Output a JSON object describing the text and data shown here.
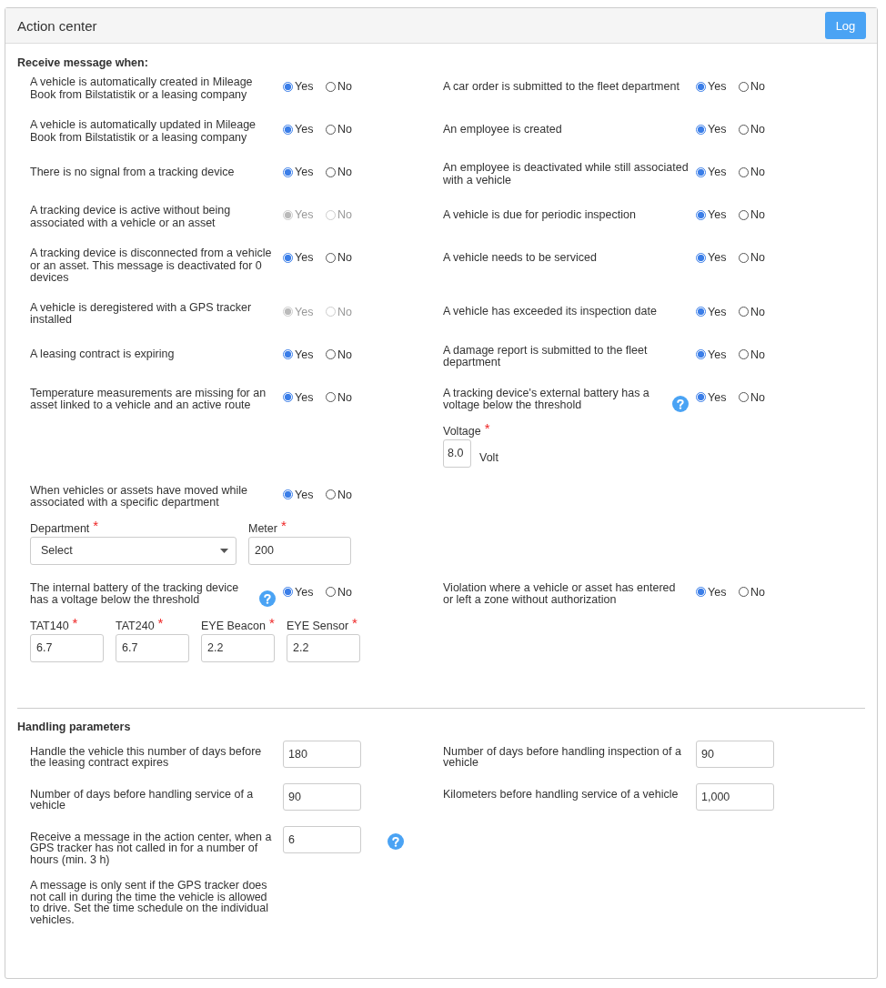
{
  "header": {
    "title": "Action center",
    "log_button": "Log"
  },
  "receive": {
    "title": "Receive message when:",
    "rows": [
      {
        "left": {
          "label": "A vehicle is automatically created in Mileage Book from Bilstatistik or a leasing company",
          "disabled": false,
          "help": false,
          "options": [
            {
              "label": "Yes",
              "selected": true
            },
            {
              "label": "No",
              "selected": false
            }
          ]
        },
        "right": {
          "label": "A car order is submitted to the fleet department",
          "disabled": false,
          "help": false,
          "options": [
            {
              "label": "Yes",
              "selected": true
            },
            {
              "label": "No",
              "selected": false
            }
          ]
        }
      },
      {
        "left": {
          "label": "A vehicle is automatically updated in Mileage Book from Bilstatistik or a leasing company",
          "disabled": false,
          "help": false,
          "options": [
            {
              "label": "Yes",
              "selected": true
            },
            {
              "label": "No",
              "selected": false
            }
          ]
        },
        "right": {
          "label": "An employee is created",
          "disabled": false,
          "help": false,
          "options": [
            {
              "label": "Yes",
              "selected": true
            },
            {
              "label": "No",
              "selected": false
            }
          ]
        }
      },
      {
        "left": {
          "label": "There is no signal from a tracking device",
          "disabled": false,
          "help": false,
          "options": [
            {
              "label": "Yes",
              "selected": true
            },
            {
              "label": "No",
              "selected": false
            }
          ]
        },
        "right": {
          "label": "An employee is deactivated while still associated with a vehicle",
          "disabled": false,
          "help": false,
          "options": [
            {
              "label": "Yes",
              "selected": true
            },
            {
              "label": "No",
              "selected": false
            }
          ]
        }
      },
      {
        "left": {
          "label": "A tracking device is active without being associated with a vehicle or an asset",
          "disabled": true,
          "help": false,
          "options": [
            {
              "label": "Yes",
              "selected": true
            },
            {
              "label": "No",
              "selected": false
            }
          ]
        },
        "right": {
          "label": "A vehicle is due for periodic inspection",
          "disabled": false,
          "help": false,
          "options": [
            {
              "label": "Yes",
              "selected": true
            },
            {
              "label": "No",
              "selected": false
            }
          ]
        }
      },
      {
        "left": {
          "label": "A tracking device is disconnected from a vehicle or an asset. This message is deactivated for 0 devices",
          "disabled": false,
          "help": false,
          "options": [
            {
              "label": "Yes",
              "selected": true
            },
            {
              "label": "No",
              "selected": false
            }
          ]
        },
        "right": {
          "label": "A vehicle needs to be serviced",
          "disabled": false,
          "help": false,
          "options": [
            {
              "label": "Yes",
              "selected": true
            },
            {
              "label": "No",
              "selected": false
            }
          ]
        }
      },
      {
        "left": {
          "label": "A vehicle is deregistered with a GPS tracker installed",
          "disabled": true,
          "help": false,
          "options": [
            {
              "label": "Yes",
              "selected": true
            },
            {
              "label": "No",
              "selected": false
            }
          ]
        },
        "right": {
          "label": "A vehicle has exceeded its inspection date",
          "disabled": false,
          "help": false,
          "options": [
            {
              "label": "Yes",
              "selected": true
            },
            {
              "label": "No",
              "selected": false
            }
          ]
        }
      },
      {
        "left": {
          "label": "A leasing contract is expiring",
          "disabled": false,
          "help": false,
          "options": [
            {
              "label": "Yes",
              "selected": true
            },
            {
              "label": "No",
              "selected": false
            }
          ]
        },
        "right": {
          "label": "A damage report is submitted to the fleet department",
          "disabled": false,
          "help": false,
          "options": [
            {
              "label": "Yes",
              "selected": true
            },
            {
              "label": "No",
              "selected": false
            }
          ]
        }
      },
      {
        "left": {
          "label": "Temperature measurements are missing for an asset linked to a vehicle and an active route",
          "disabled": false,
          "help": false,
          "options": [
            {
              "label": "Yes",
              "selected": true
            },
            {
              "label": "No",
              "selected": false
            }
          ]
        },
        "right": {
          "label": "A tracking device's external battery has a voltage below the threshold",
          "disabled": false,
          "help": true,
          "options": [
            {
              "label": "Yes",
              "selected": true
            },
            {
              "label": "No",
              "selected": false
            }
          ],
          "fields": [
            {
              "kind": "input",
              "label": "Voltage",
              "required_mark": "*",
              "value": "8.0",
              "unit": "Volt"
            }
          ]
        }
      },
      {
        "left": {
          "label": "When vehicles or assets have moved while associated with a specific department",
          "disabled": false,
          "help": false,
          "options": [
            {
              "label": "Yes",
              "selected": true
            },
            {
              "label": "No",
              "selected": false
            }
          ],
          "fields": [
            {
              "kind": "select",
              "label": "Department",
              "required_mark": "*",
              "value": "Select"
            },
            {
              "kind": "input",
              "label": "Meter",
              "required_mark": "*",
              "value": "200"
            }
          ]
        }
      },
      {
        "left": {
          "label": "The internal battery of the tracking device has a voltage below the threshold",
          "disabled": false,
          "help": true,
          "options": [
            {
              "label": "Yes",
              "selected": true
            },
            {
              "label": "No",
              "selected": false
            }
          ],
          "fields": [
            {
              "kind": "input",
              "label": "TAT140",
              "required_mark": "*",
              "value": "6.7"
            },
            {
              "kind": "input",
              "label": "TAT240",
              "required_mark": "*",
              "value": "6.7"
            },
            {
              "kind": "input",
              "label": "EYE Beacon",
              "required_mark": "*",
              "value": "2.2"
            },
            {
              "kind": "input",
              "label": "EYE Sensor",
              "required_mark": "*",
              "value": "2.2"
            }
          ]
        },
        "right": {
          "label": "Violation where a vehicle or asset has entered or left a zone without authorization",
          "disabled": false,
          "help": false,
          "options": [
            {
              "label": "Yes",
              "selected": true
            },
            {
              "label": "No",
              "selected": false
            }
          ]
        }
      }
    ]
  },
  "handling": {
    "title": "Handling parameters",
    "rows": [
      {
        "left": {
          "label": "Handle the vehicle this number of days before the leasing contract expires",
          "value": "180",
          "help": false
        },
        "right": {
          "label": "Number of days before handling inspection of a vehicle",
          "value": "90",
          "help": false
        }
      },
      {
        "left": {
          "label": "Number of days before handling service of a vehicle",
          "value": "90",
          "help": false
        },
        "right": {
          "label": "Kilometers before handling service of a vehicle",
          "value": "1,000",
          "help": false
        }
      },
      {
        "left": {
          "label": "Receive a message in the action center, when a GPS tracker has not called in for a number of hours (min. 3 h)",
          "value": "6",
          "help": true
        }
      }
    ],
    "note": "A message is only sent if the GPS tracker does not call in during the time the vehicle is allowed to drive. Set the time schedule on the individual vehicles."
  }
}
